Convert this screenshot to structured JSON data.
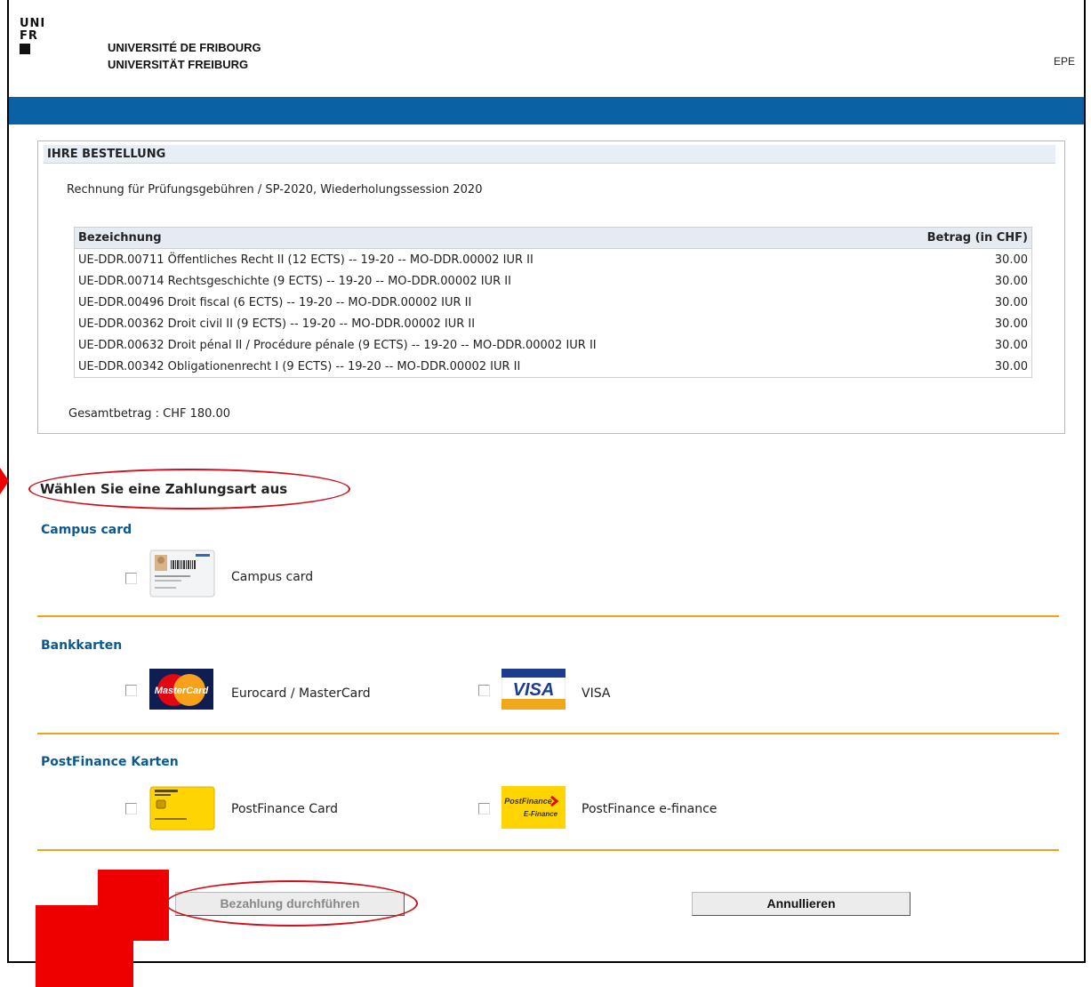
{
  "header": {
    "logo_lines": [
      "UNI",
      "FR"
    ],
    "university_fr": "UNIVERSITÉ DE FRIBOURG",
    "university_de": "UNIVERSITÄT FREIBURG",
    "epe": "EPE",
    "brand_blue": "#0a62a4"
  },
  "order": {
    "heading": "IHRE BESTELLUNG",
    "invoice_title": "Rechnung für Prüfungsgebühren / SP-2020, Wiederholungssession 2020",
    "col_description": "Bezeichnung",
    "col_amount": "Betrag (in CHF)",
    "items": [
      {
        "description": "UE-DDR.00711 Öffentliches Recht II (12 ECTS) -- 19-20 -- MO-DDR.00002 IUR II",
        "amount": "30.00"
      },
      {
        "description": "UE-DDR.00714 Rechtsgeschichte (9 ECTS) -- 19-20 -- MO-DDR.00002 IUR II",
        "amount": "30.00"
      },
      {
        "description": "UE-DDR.00496 Droit fiscal (6 ECTS) -- 19-20 -- MO-DDR.00002 IUR II",
        "amount": "30.00"
      },
      {
        "description": "UE-DDR.00362 Droit civil II (9 ECTS) -- 19-20 -- MO-DDR.00002 IUR II",
        "amount": "30.00"
      },
      {
        "description": "UE-DDR.00632 Droit pénal II / Procédure pénale (9 ECTS) -- 19-20 -- MO-DDR.00002 IUR II",
        "amount": "30.00"
      },
      {
        "description": "UE-DDR.00342 Obligationenrecht I (9 ECTS) -- 19-20 -- MO-DDR.00002 IUR II",
        "amount": "30.00"
      }
    ],
    "total": "Gesamtbetrag : CHF 180.00"
  },
  "payment": {
    "heading": "Wählen Sie eine Zahlungsart aus",
    "sections": {
      "campus": {
        "title": "Campus card",
        "options": [
          {
            "label": "Campus card",
            "icon": "campus-card-icon",
            "checked": false
          }
        ]
      },
      "bank": {
        "title": "Bankkarten",
        "options": [
          {
            "label": "Eurocard / MasterCard",
            "icon": "mastercard-icon",
            "checked": false
          },
          {
            "label": "VISA",
            "icon": "visa-icon",
            "checked": false
          }
        ]
      },
      "postfinance": {
        "title": "PostFinance Karten",
        "options": [
          {
            "label": "PostFinance Card",
            "icon": "postfinance-card-icon",
            "checked": false
          },
          {
            "label": "PostFinance e-finance",
            "icon": "postfinance-efinance-icon",
            "checked": false
          }
        ]
      }
    },
    "separator_color": "#f0a020",
    "section_title_color": "#0b5a8f"
  },
  "actions": {
    "pay_label": "Bezahlung durchführen",
    "pay_disabled": true,
    "cancel_label": "Annullieren"
  },
  "annotation": {
    "highlight_color": "#d0101a",
    "arrow_color": "#ee0000"
  },
  "card_logos": {
    "mastercard": "MasterCard",
    "visa": "VISA",
    "postfinance": "PostFinance",
    "efinance": "E-Finance"
  }
}
